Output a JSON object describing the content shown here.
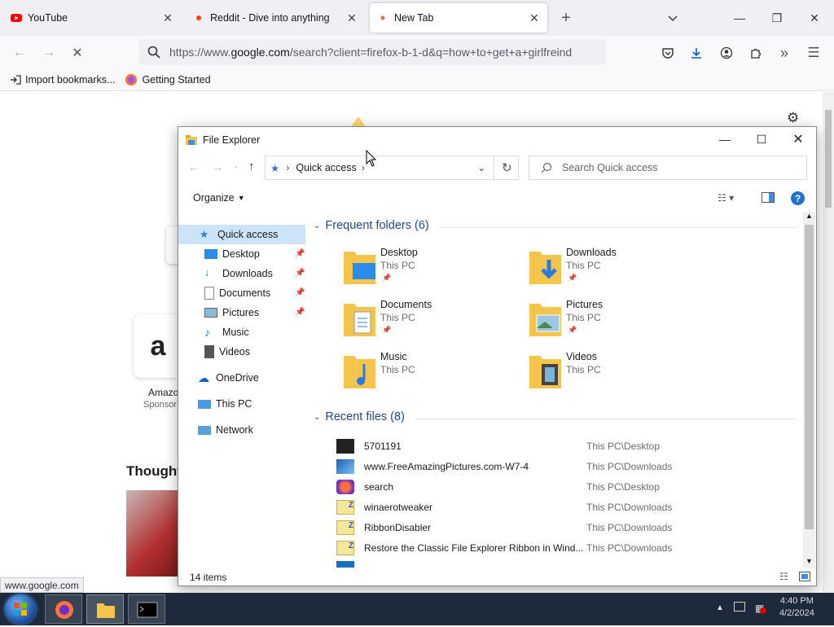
{
  "browser": {
    "tabs": [
      {
        "title": "YouTube"
      },
      {
        "title": "Reddit - Dive into anything"
      },
      {
        "title": "New Tab"
      }
    ],
    "url_prefix": "https://www.",
    "url_host": "google.com",
    "url_rest": "/search?client=firefox-b-1-d&q=how+to+get+a+girlfreind",
    "bookmarks": [
      "Import bookmarks...",
      "Getting Started"
    ],
    "status_url": "www.google.com"
  },
  "page": {
    "shortcut_label": "Amazo",
    "shortcut_sub": "Sponsor",
    "section_title": "Thought"
  },
  "explorer": {
    "title": "File Explorer",
    "address": "Quick access",
    "search_placeholder": "Search Quick access",
    "organize": "Organize",
    "nav": [
      {
        "label": "Quick access",
        "pinned": false
      },
      {
        "label": "Desktop",
        "pinned": true
      },
      {
        "label": "Downloads",
        "pinned": true
      },
      {
        "label": "Documents",
        "pinned": true
      },
      {
        "label": "Pictures",
        "pinned": true
      },
      {
        "label": "Music",
        "pinned": false
      },
      {
        "label": "Videos",
        "pinned": false
      },
      {
        "label": "OneDrive",
        "pinned": false
      },
      {
        "label": "This PC",
        "pinned": false
      },
      {
        "label": "Network",
        "pinned": false
      }
    ],
    "frequent_header": "Frequent folders (6)",
    "folders": [
      {
        "name": "Desktop",
        "sub": "This PC",
        "pinned": true
      },
      {
        "name": "Downloads",
        "sub": "This PC",
        "pinned": true
      },
      {
        "name": "Documents",
        "sub": "This PC",
        "pinned": true
      },
      {
        "name": "Pictures",
        "sub": "This PC",
        "pinned": true
      },
      {
        "name": "Music",
        "sub": "This PC",
        "pinned": false
      },
      {
        "name": "Videos",
        "sub": "This PC",
        "pinned": false
      }
    ],
    "recent_header": "Recent files (8)",
    "recent": [
      {
        "name": "5701191",
        "location": "This PC\\Desktop"
      },
      {
        "name": "www.FreeAmazingPictures.com-W7-4",
        "location": "This PC\\Downloads"
      },
      {
        "name": "search",
        "location": "This PC\\Desktop"
      },
      {
        "name": "winaerotweaker",
        "location": "This PC\\Downloads"
      },
      {
        "name": "RibbonDisabler",
        "location": "This PC\\Downloads"
      },
      {
        "name": "Restore the Classic File Explorer Ribbon in Wind...",
        "location": "This PC\\Downloads"
      }
    ],
    "status": "14 items"
  },
  "taskbar": {
    "time": "4:40 PM",
    "date": "4/2/2024"
  }
}
